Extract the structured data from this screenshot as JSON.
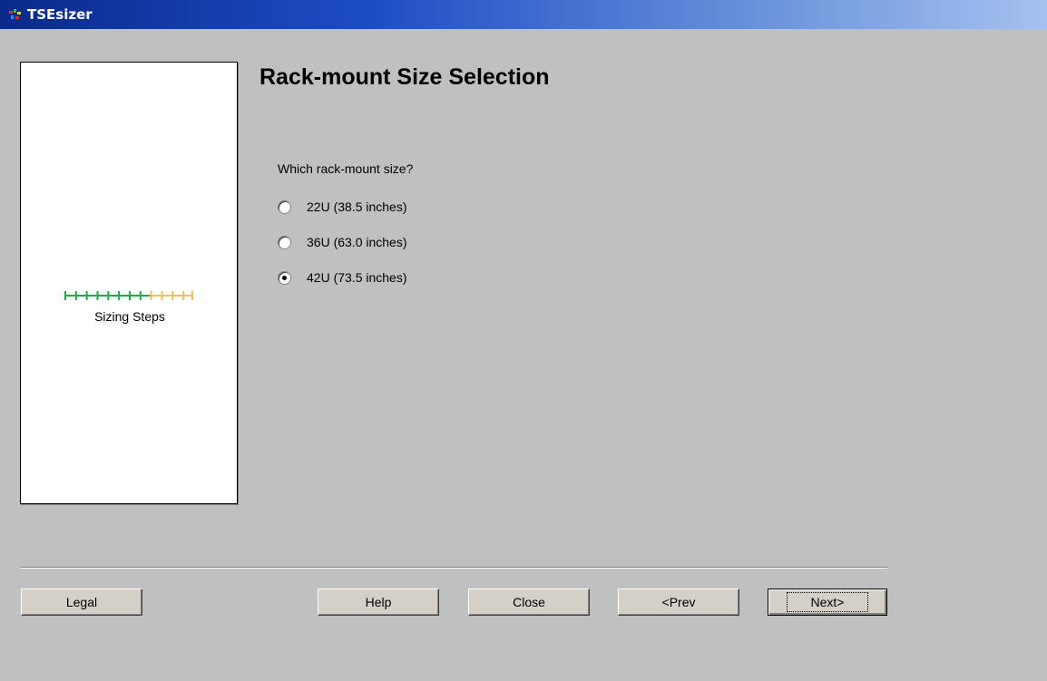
{
  "window": {
    "title": "TSEsizer",
    "icon": "app-icon"
  },
  "side_panel": {
    "steps_label": "Sizing Steps",
    "steps_progress": {
      "completed": 8,
      "total": 12,
      "completed_color": "#22a84a",
      "remaining_color": "#f0c060"
    }
  },
  "main": {
    "title": "Rack-mount Size Selection",
    "question": "Which rack-mount size?",
    "options": [
      {
        "label": "22U (38.5 inches)",
        "selected": false
      },
      {
        "label": "36U (63.0 inches)",
        "selected": false
      },
      {
        "label": "42U (73.5 inches)",
        "selected": true
      }
    ]
  },
  "buttons": {
    "legal": "Legal",
    "help": "Help",
    "close": "Close",
    "prev": "<Prev",
    "next": "Next>"
  }
}
